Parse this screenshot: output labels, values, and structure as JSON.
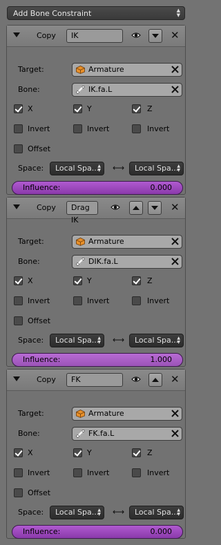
{
  "header": {
    "add_constraint_label": "Add Bone Constraint"
  },
  "labels": {
    "copy": "Copy",
    "target": "Target:",
    "bone": "Bone:",
    "x": "X",
    "y": "Y",
    "z": "Z",
    "invert": "Invert",
    "offset": "Offset",
    "space": "Space:",
    "influence": "Influence:"
  },
  "constraints": [
    {
      "name": "IK",
      "target": "Armature",
      "bone": "IK.fa.L",
      "x": true,
      "y": true,
      "z": true,
      "invert_x": false,
      "invert_y": false,
      "invert_z": false,
      "offset": false,
      "owner_space": "Local Spa...",
      "target_space": "Local Spa...",
      "influence": "0.000",
      "influence_fraction": 0.0,
      "move_buttons": [
        "down"
      ]
    },
    {
      "name": "Drag IK",
      "target": "Armature",
      "bone": "DIK.fa.L",
      "x": true,
      "y": true,
      "z": true,
      "invert_x": false,
      "invert_y": false,
      "invert_z": false,
      "offset": false,
      "owner_space": "Local Spa...",
      "target_space": "Local Spa...",
      "influence": "1.000",
      "influence_fraction": 1.0,
      "move_buttons": [
        "up",
        "down"
      ]
    },
    {
      "name": "FK",
      "target": "Armature",
      "bone": "FK.fa.L",
      "x": true,
      "y": true,
      "z": true,
      "invert_x": false,
      "invert_y": false,
      "invert_z": false,
      "offset": false,
      "owner_space": "Local Spa...",
      "target_space": "Local Spa...",
      "influence": "0.000",
      "influence_fraction": 0.0,
      "move_buttons": [
        "up"
      ]
    }
  ],
  "colors": {
    "influence_bar": "#9b4cbf",
    "panel": "#727272",
    "dark_select": "#333333"
  },
  "icons": [
    "collapse-triangle-icon",
    "eye-icon",
    "move-up-icon",
    "move-down-icon",
    "close-icon",
    "armature-object-icon",
    "bone-icon",
    "swap-arrows-icon"
  ]
}
